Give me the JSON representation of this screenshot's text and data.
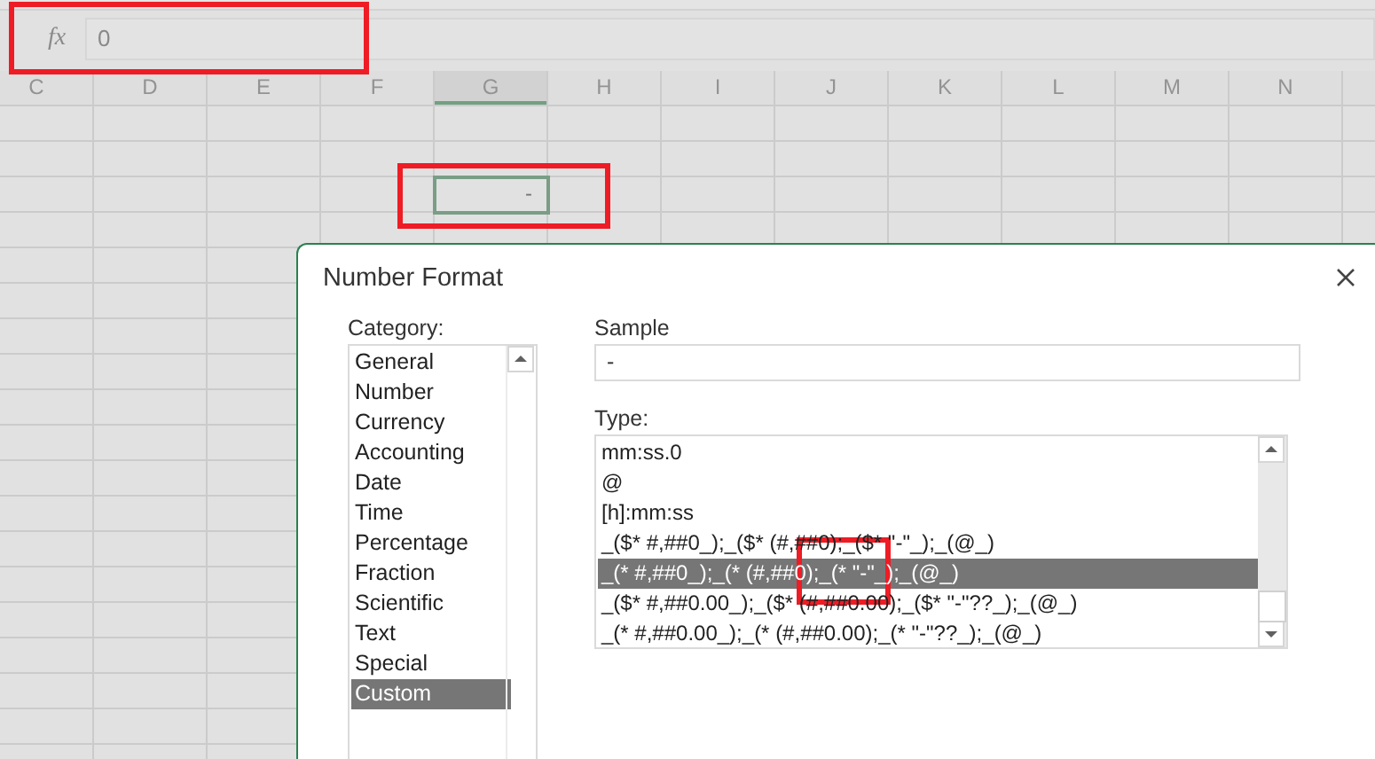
{
  "formula_bar": {
    "fx": "fx",
    "value": "0",
    "highlighted": true
  },
  "columns": [
    {
      "label": "C",
      "selected": false
    },
    {
      "label": "D",
      "selected": false
    },
    {
      "label": "E",
      "selected": false
    },
    {
      "label": "F",
      "selected": false
    },
    {
      "label": "G",
      "selected": true
    },
    {
      "label": "H",
      "selected": false
    },
    {
      "label": "I",
      "selected": false
    },
    {
      "label": "J",
      "selected": false
    },
    {
      "label": "K",
      "selected": false
    },
    {
      "label": "L",
      "selected": false
    },
    {
      "label": "M",
      "selected": false
    },
    {
      "label": "N",
      "selected": false
    }
  ],
  "active_cell": {
    "value": "-",
    "highlighted": true
  },
  "dialog": {
    "title": "Number Format",
    "category_label": "Category:",
    "categories": [
      {
        "label": "General",
        "selected": false
      },
      {
        "label": "Number",
        "selected": false
      },
      {
        "label": "Currency",
        "selected": false
      },
      {
        "label": "Accounting",
        "selected": false
      },
      {
        "label": "Date",
        "selected": false
      },
      {
        "label": "Time",
        "selected": false
      },
      {
        "label": "Percentage",
        "selected": false
      },
      {
        "label": "Fraction",
        "selected": false
      },
      {
        "label": "Scientific",
        "selected": false
      },
      {
        "label": "Text",
        "selected": false
      },
      {
        "label": "Special",
        "selected": false
      },
      {
        "label": "Custom",
        "selected": true
      }
    ],
    "sample_label": "Sample",
    "sample_value": "-",
    "type_label": "Type:",
    "types_highlighted": true,
    "types": [
      {
        "label": "mm:ss.0",
        "selected": false
      },
      {
        "label": "@",
        "selected": false
      },
      {
        "label": "[h]:mm:ss",
        "selected": false
      },
      {
        "label": "_($* #,##0_);_($* (#,##0);_($* \"-\"_);_(@_)",
        "selected": false
      },
      {
        "label": "_(* #,##0_);_(* (#,##0);_(* \"-\"_);_(@_)",
        "selected": true
      },
      {
        "label": "_($* #,##0.00_);_($* (#,##0.00);_($* \"-\"??_);_(@_)",
        "selected": false
      },
      {
        "label": "_(* #,##0.00_);_(* (#,##0.00);_(* \"-\"??_);_(@_)",
        "selected": false
      }
    ]
  }
}
